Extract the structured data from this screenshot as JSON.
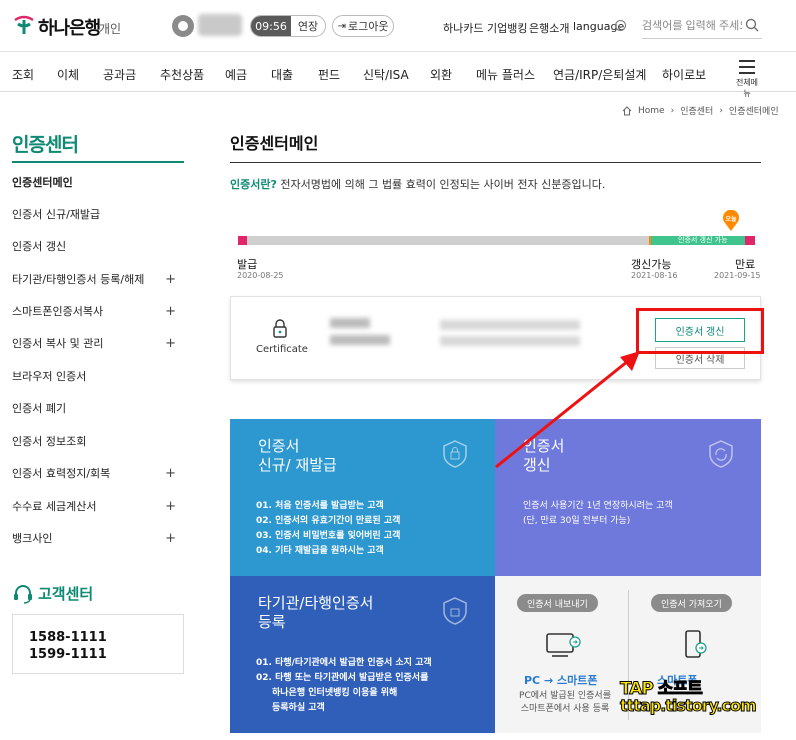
{
  "header": {
    "bank_name": "하나은행",
    "bank_sub": "개인",
    "timer": "09:56",
    "extend_label": "연장",
    "logout_label": "로그아웃",
    "links": [
      "하나카드",
      "기업뱅킹",
      "은행소개",
      "language"
    ],
    "search_placeholder": "검색어를 입력해 주세요."
  },
  "gnb": {
    "items": [
      "조회",
      "이체",
      "공과금",
      "추천상품",
      "예금",
      "대출",
      "펀드",
      "신탁/ISA",
      "외환",
      "메뉴 플러스",
      "연금/IRP/은퇴설계",
      "하이로보"
    ],
    "all_menu_label": "전체메뉴"
  },
  "breadcrumb": [
    "Home",
    "인증센터",
    "인증센터메인"
  ],
  "sidebar": {
    "title": "인증센터",
    "items": [
      {
        "label": "인증센터메인",
        "plus": ""
      },
      {
        "label": "인증서 신규/재발급",
        "plus": ""
      },
      {
        "label": "인증서 갱신",
        "plus": ""
      },
      {
        "label": "타기관/타행인증서 등록/해제",
        "plus": "+"
      },
      {
        "label": "스마트폰인증서복사",
        "plus": "+"
      },
      {
        "label": "인증서 복사 및 관리",
        "plus": "+"
      },
      {
        "label": "브라우저 인증서",
        "plus": ""
      },
      {
        "label": "인증서 폐기",
        "plus": ""
      },
      {
        "label": "인증서 정보조회",
        "plus": ""
      },
      {
        "label": "인증서 효력정지/회복",
        "plus": "+"
      },
      {
        "label": "수수료 세금계산서",
        "plus": "+"
      },
      {
        "label": "뱅크사인",
        "plus": "+"
      }
    ],
    "customer_center_title": "고객센터",
    "phones": [
      "1588-1111",
      "1599-1111"
    ]
  },
  "main": {
    "title": "인증센터메인",
    "intro_highlight": "인증서란?",
    "intro_text": " 전자서명법에 의해 그 법률 효력이 인정되는 사이버 전자 신분증입니다.",
    "timeline": {
      "today_label": "오늘",
      "renew_range_label": "인증서 갱신 가능",
      "issue_label": "발급",
      "issue_date": "2020-08-25",
      "renew_label": "갱신가능",
      "renew_date": "2021-08-16",
      "expire_label": "만료",
      "expire_date": "2021-09-15"
    },
    "cert": {
      "label": "Certificate",
      "renew_button": "인증서 갱신",
      "delete_button": "인증서 삭제"
    },
    "tiles": [
      {
        "title_line1": "인증서",
        "title_line2": "신규/ 재발급",
        "items": [
          "01. 처음 인증서를 발급받는 고객",
          "02. 인증서의 유효기간이 만료된 고객",
          "03. 인증서 비밀번호를 잊어버린 고객",
          "04. 기타 재발급을 원하시는 고객"
        ]
      },
      {
        "title_line1": "인증서",
        "title_line2": "갱신",
        "desc1": "인증서 사용기간 1년 연장하시려는 고객",
        "desc2": "(단, 만료 30일 전부터 가능)"
      },
      {
        "title_line1": "타기관/타행인증서",
        "title_line2": "등록",
        "items": [
          "01. 타행/타기관에서 발급한 인증서 소지 고객",
          "02. 타행 또는 타기관에서 발급받은 인증서를",
          "하나은행 인터넷뱅킹 이용을 위해",
          "등록하실 고객"
        ]
      },
      {
        "export_pill": "인증서 내보내기",
        "import_pill": "인증서 가져오기",
        "pc_title": "PC → 스마트폰",
        "pc_desc1": "PC에서 발급된 인증서를",
        "pc_desc2": "스마트폰에서 사용 등록",
        "phone_title": "스마트폰"
      }
    ]
  },
  "watermark": {
    "line1": "TAP 소프트",
    "line2": "tttap.tistory.com"
  },
  "colors": {
    "brand": "#0e8a74",
    "highlight": "#ee1111",
    "tile1": "#2d97cf",
    "tile2": "#6f79db",
    "tile3": "#2f5fb8"
  }
}
